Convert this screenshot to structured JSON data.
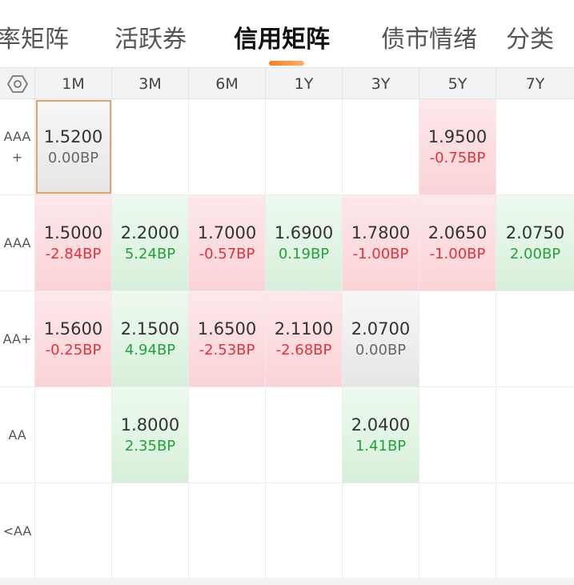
{
  "tabs": [
    {
      "label": "率矩阵",
      "active": false
    },
    {
      "label": "活跃券",
      "active": false
    },
    {
      "label": "信用矩阵",
      "active": true
    },
    {
      "label": "债市情绪",
      "active": false
    },
    {
      "label": "分类",
      "active": false
    }
  ],
  "colors": {
    "accent": "#ff7a1a",
    "up": "#e2323a",
    "down": "#22a33a"
  },
  "matrix": {
    "settings_icon": "hexagon-settings-icon",
    "columns": [
      "1M",
      "3M",
      "6M",
      "1Y",
      "3Y",
      "5Y",
      "7Y"
    ],
    "rows": [
      {
        "label_line1": "AAA",
        "label_line2": "+",
        "cells": [
          {
            "rate": "1.5200",
            "change": "0.00BP",
            "tone": "gray",
            "selected": true
          },
          null,
          null,
          null,
          null,
          {
            "rate": "1.9500",
            "change": "-0.75BP",
            "tone": "red"
          },
          null
        ]
      },
      {
        "label_line1": "AAA",
        "label_line2": "",
        "cells": [
          {
            "rate": "1.5000",
            "change": "-2.84BP",
            "tone": "red"
          },
          {
            "rate": "2.2000",
            "change": "5.24BP",
            "tone": "green"
          },
          {
            "rate": "1.7000",
            "change": "-0.57BP",
            "tone": "red"
          },
          {
            "rate": "1.6900",
            "change": "0.19BP",
            "tone": "green"
          },
          {
            "rate": "1.7800",
            "change": "-1.00BP",
            "tone": "red"
          },
          {
            "rate": "2.0650",
            "change": "-1.00BP",
            "tone": "red"
          },
          {
            "rate": "2.0750",
            "change": "2.00BP",
            "tone": "green"
          }
        ]
      },
      {
        "label_line1": "AA+",
        "label_line2": "",
        "cells": [
          {
            "rate": "1.5600",
            "change": "-0.25BP",
            "tone": "red"
          },
          {
            "rate": "2.1500",
            "change": "4.94BP",
            "tone": "green"
          },
          {
            "rate": "1.6500",
            "change": "-2.53BP",
            "tone": "red"
          },
          {
            "rate": "2.1100",
            "change": "-2.68BP",
            "tone": "red"
          },
          {
            "rate": "2.0700",
            "change": "0.00BP",
            "tone": "gray"
          },
          null,
          null
        ]
      },
      {
        "label_line1": "AA",
        "label_line2": "",
        "cells": [
          null,
          {
            "rate": "1.8000",
            "change": "2.35BP",
            "tone": "green"
          },
          null,
          null,
          {
            "rate": "2.0400",
            "change": "1.41BP",
            "tone": "green"
          },
          null,
          null
        ]
      },
      {
        "label_line1": "<AA",
        "label_line2": "",
        "cells": [
          null,
          null,
          null,
          null,
          null,
          null,
          null
        ]
      }
    ]
  }
}
